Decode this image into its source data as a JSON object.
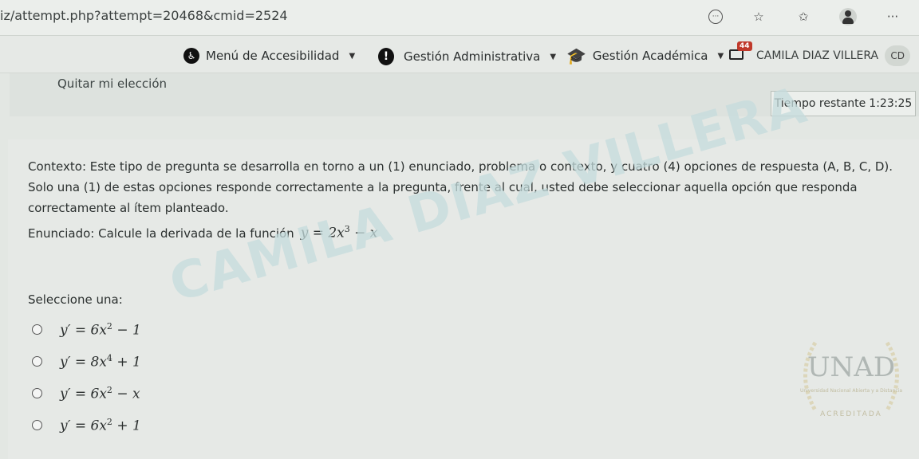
{
  "browser": {
    "url": "iz/attempt.php?attempt=20468&cmid=2524",
    "icons": [
      "reader-icon",
      "favorite-star-icon",
      "favorites-bar-icon",
      "profile-icon",
      "more-icon"
    ]
  },
  "nav": {
    "accessibility_menu": "Menú de Accesibilidad",
    "administrative": "Gestión Administrativa",
    "academic": "Gestión Académica",
    "messages_count": "44",
    "user_name": "CAMILA DIAZ VILLERA",
    "user_initials": "CD"
  },
  "quiz": {
    "clear_choice": "Quitar mi elección",
    "timer_label": "Tiempo restante",
    "timer_value": "1:23:25",
    "context": "Contexto: Este tipo de pregunta se desarrolla en torno a un (1) enunciado, problema o contexto, y cuatro (4) opciones de respuesta (A, B, C, D). Solo una (1) de estas opciones responde correctamente a la pregunta, frente al cual, usted debe seleccionar aquella opción que responda correctamente al ítem planteado.",
    "statement_label": "Enunciado: Calcule la derivada de la función",
    "statement_math": {
      "lhs": "y = 2x",
      "exp": "3",
      "rhs": " − x"
    },
    "select_label": "Seleccione una:",
    "options": [
      {
        "base": "y′ = 6x",
        "exp": "2",
        "tail": " − 1"
      },
      {
        "base": "y′ = 8x",
        "exp": "4",
        "tail": " + 1"
      },
      {
        "base": "y′ = 6x",
        "exp": "2",
        "tail": " − x"
      },
      {
        "base": "y′ = 6x",
        "exp": "2",
        "tail": " + 1"
      }
    ]
  },
  "watermark": "CAMILA DIAZ VILLERA",
  "logo": {
    "text": "UNAD",
    "subtitle": "Universidad Nacional Abierta y a Distancia",
    "accredited": "ACREDITADA"
  }
}
